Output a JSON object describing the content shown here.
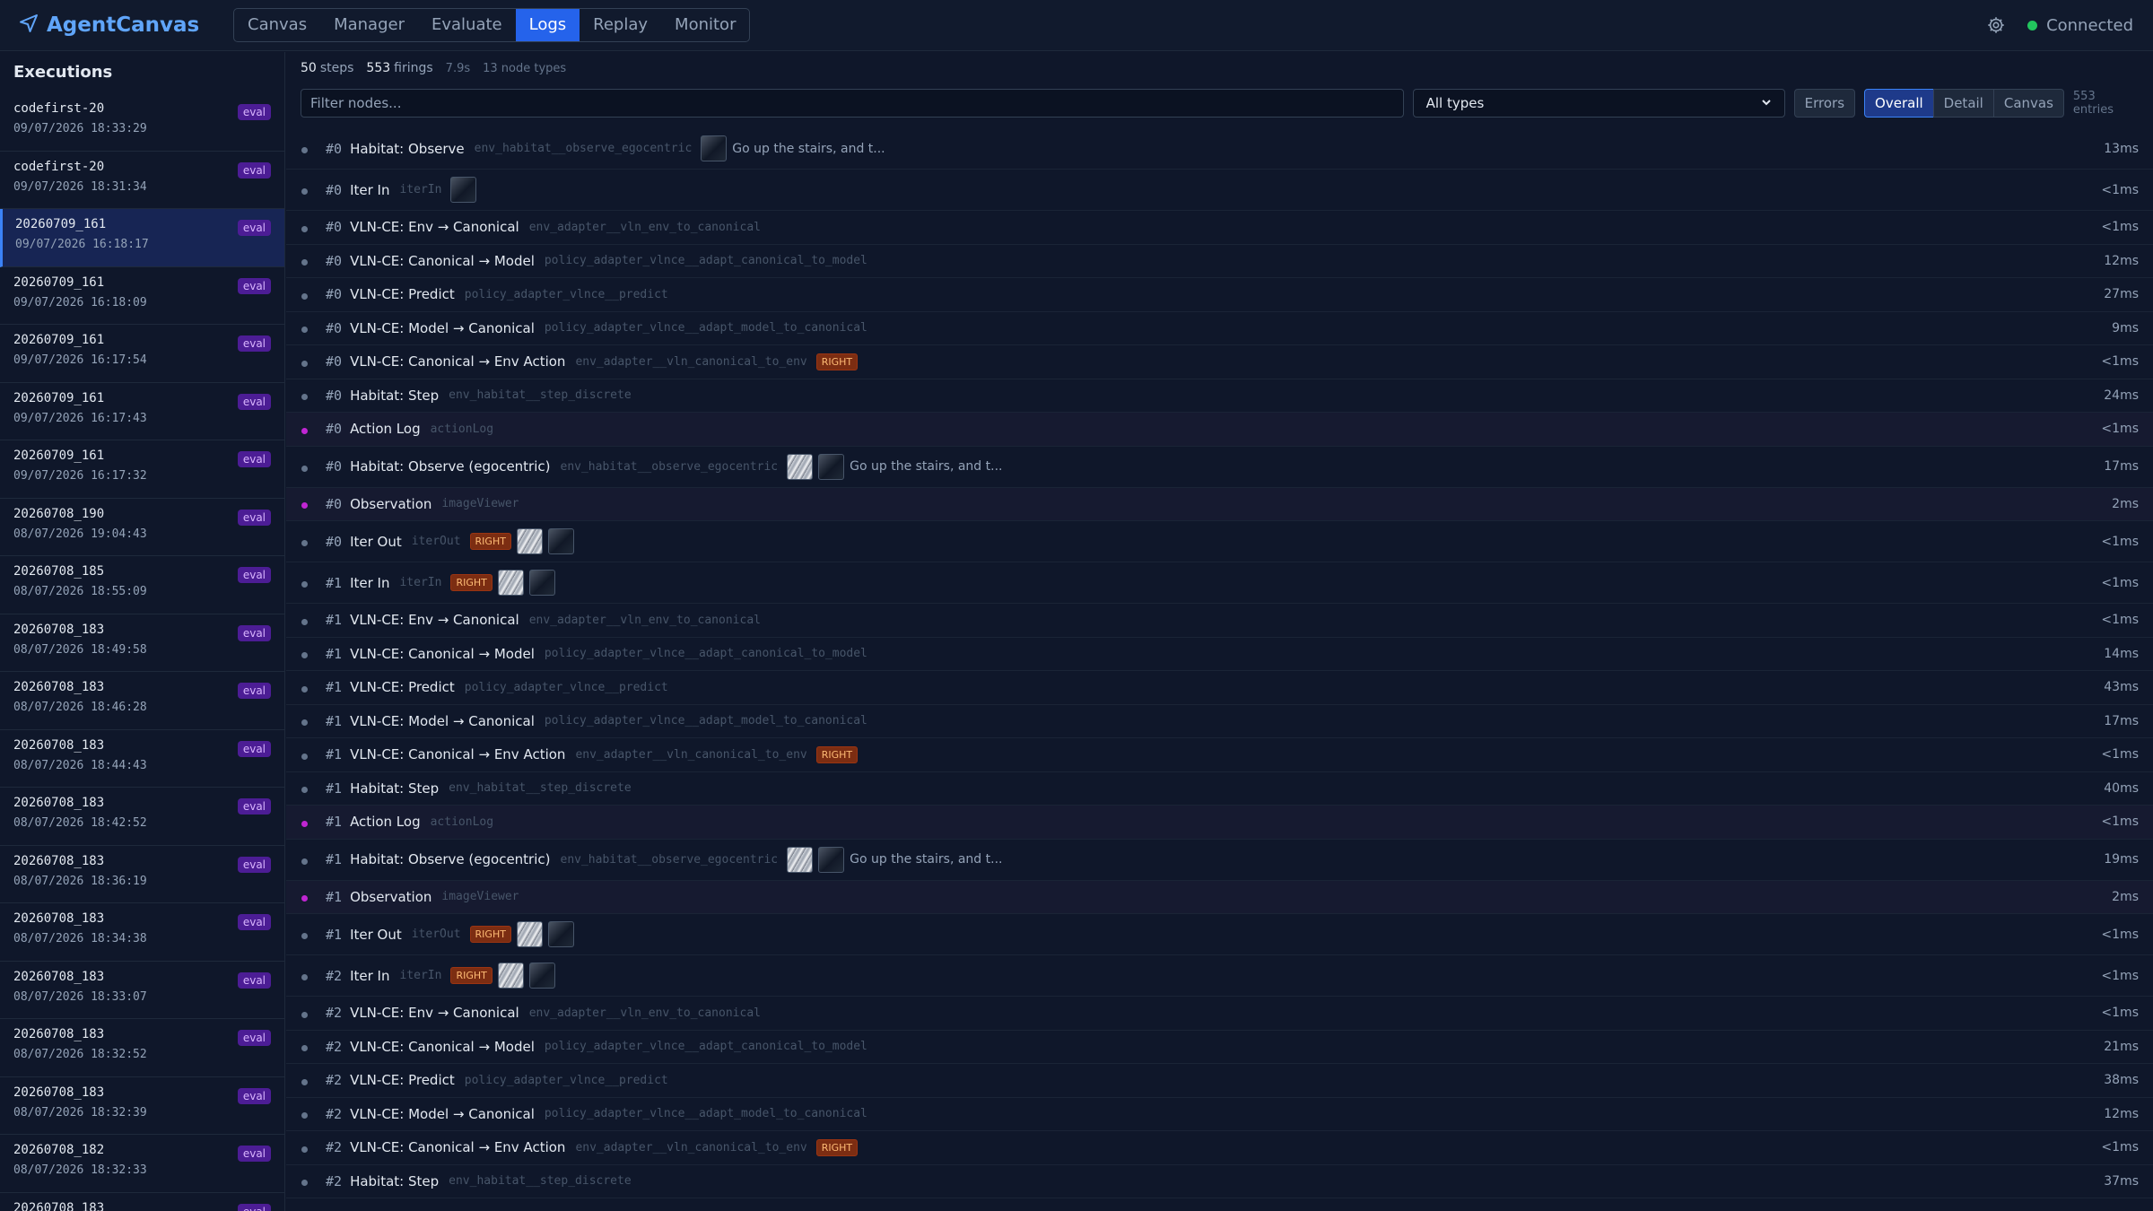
{
  "app": {
    "title": "AgentCanvas"
  },
  "nav": {
    "tabs": [
      {
        "label": "Canvas"
      },
      {
        "label": "Manager"
      },
      {
        "label": "Evaluate"
      },
      {
        "label": "Logs"
      },
      {
        "label": "Replay"
      },
      {
        "label": "Monitor"
      }
    ],
    "active": "Logs"
  },
  "status": {
    "label": "Connected"
  },
  "sidebar": {
    "title": "Executions",
    "items": [
      {
        "name": "codefirst-20",
        "date": "09/07/2026 18:33:29",
        "badge": "eval"
      },
      {
        "name": "codefirst-20",
        "date": "09/07/2026 18:31:34",
        "badge": "eval"
      },
      {
        "name": "20260709_161",
        "date": "09/07/2026 16:18:17",
        "badge": "eval"
      },
      {
        "name": "20260709_161",
        "date": "09/07/2026 16:18:09",
        "badge": "eval"
      },
      {
        "name": "20260709_161",
        "date": "09/07/2026 16:17:54",
        "badge": "eval"
      },
      {
        "name": "20260709_161",
        "date": "09/07/2026 16:17:43",
        "badge": "eval"
      },
      {
        "name": "20260709_161",
        "date": "09/07/2026 16:17:32",
        "badge": "eval"
      },
      {
        "name": "20260708_190",
        "date": "08/07/2026 19:04:43",
        "badge": "eval"
      },
      {
        "name": "20260708_185",
        "date": "08/07/2026 18:55:09",
        "badge": "eval"
      },
      {
        "name": "20260708_183",
        "date": "08/07/2026 18:49:58",
        "badge": "eval"
      },
      {
        "name": "20260708_183",
        "date": "08/07/2026 18:46:28",
        "badge": "eval"
      },
      {
        "name": "20260708_183",
        "date": "08/07/2026 18:44:43",
        "badge": "eval"
      },
      {
        "name": "20260708_183",
        "date": "08/07/2026 18:42:52",
        "badge": "eval"
      },
      {
        "name": "20260708_183",
        "date": "08/07/2026 18:36:19",
        "badge": "eval"
      },
      {
        "name": "20260708_183",
        "date": "08/07/2026 18:34:38",
        "badge": "eval"
      },
      {
        "name": "20260708_183",
        "date": "08/07/2026 18:33:07",
        "badge": "eval"
      },
      {
        "name": "20260708_183",
        "date": "08/07/2026 18:32:52",
        "badge": "eval"
      },
      {
        "name": "20260708_183",
        "date": "08/07/2026 18:32:39",
        "badge": "eval"
      },
      {
        "name": "20260708_182",
        "date": "08/07/2026 18:32:33",
        "badge": "eval"
      },
      {
        "name": "20260708_183",
        "date": "",
        "badge": "eval"
      }
    ]
  },
  "stats": {
    "steps_value": "50",
    "steps_label": "steps",
    "firings_value": "553",
    "firings_label": "firings",
    "duration": "7.9s",
    "node_types": "13 node types"
  },
  "filter": {
    "placeholder": "Filter nodes...",
    "type_select": "All types",
    "errors_label": "Errors",
    "view_modes": [
      "Overall",
      "Detail",
      "Canvas"
    ],
    "active_mode": "Overall",
    "entries": "553 entries"
  },
  "logs": [
    {
      "step": "#0",
      "name": "Habitat: Observe",
      "func": "env_habitat__observe_egocentric",
      "thumbs": [
        "dark"
      ],
      "text": "Go up the stairs, and t...",
      "time": "13ms",
      "tall": true
    },
    {
      "step": "#0",
      "name": "Iter In",
      "func": "iterIn",
      "thumbs": [
        "dark"
      ],
      "time": "<1ms",
      "tall": true
    },
    {
      "step": "#0",
      "name": "VLN-CE: Env → Canonical",
      "func": "env_adapter__vln_env_to_canonical",
      "time": "<1ms"
    },
    {
      "step": "#0",
      "name": "VLN-CE: Canonical → Model",
      "func": "policy_adapter_vlnce__adapt_canonical_to_model",
      "time": "12ms"
    },
    {
      "step": "#0",
      "name": "VLN-CE: Predict",
      "func": "policy_adapter_vlnce__predict",
      "time": "27ms"
    },
    {
      "step": "#0",
      "name": "VLN-CE: Model → Canonical",
      "func": "policy_adapter_vlnce__adapt_model_to_canonical",
      "time": "9ms"
    },
    {
      "step": "#0",
      "name": "VLN-CE: Canonical → Env Action",
      "func": "env_adapter__vln_canonical_to_env",
      "badge": "RIGHT",
      "time": "<1ms"
    },
    {
      "step": "#0",
      "name": "Habitat: Step",
      "func": "env_habitat__step_discrete",
      "time": "24ms"
    },
    {
      "step": "#0",
      "name": "Action Log",
      "func": "actionLog",
      "time": "<1ms",
      "purple": true
    },
    {
      "step": "#0",
      "name": "Habitat: Observe (egocentric)",
      "func": "env_habitat__observe_egocentric",
      "thumbs": [
        "stripe",
        "dark"
      ],
      "text": "Go up the stairs, and t...",
      "time": "17ms",
      "tall": true
    },
    {
      "step": "#0",
      "name": "Observation",
      "func": "imageViewer",
      "time": "2ms",
      "purple": true
    },
    {
      "step": "#0",
      "name": "Iter Out",
      "func": "iterOut",
      "badge": "RIGHT",
      "thumbs": [
        "stripe",
        "dark"
      ],
      "time": "<1ms",
      "tall": true
    },
    {
      "step": "#1",
      "name": "Iter In",
      "func": "iterIn",
      "badge": "RIGHT",
      "thumbs": [
        "stripe",
        "dark"
      ],
      "time": "<1ms",
      "tall": true
    },
    {
      "step": "#1",
      "name": "VLN-CE: Env → Canonical",
      "func": "env_adapter__vln_env_to_canonical",
      "time": "<1ms"
    },
    {
      "step": "#1",
      "name": "VLN-CE: Canonical → Model",
      "func": "policy_adapter_vlnce__adapt_canonical_to_model",
      "time": "14ms"
    },
    {
      "step": "#1",
      "name": "VLN-CE: Predict",
      "func": "policy_adapter_vlnce__predict",
      "time": "43ms"
    },
    {
      "step": "#1",
      "name": "VLN-CE: Model → Canonical",
      "func": "policy_adapter_vlnce__adapt_model_to_canonical",
      "time": "17ms"
    },
    {
      "step": "#1",
      "name": "VLN-CE: Canonical → Env Action",
      "func": "env_adapter__vln_canonical_to_env",
      "badge": "RIGHT",
      "time": "<1ms"
    },
    {
      "step": "#1",
      "name": "Habitat: Step",
      "func": "env_habitat__step_discrete",
      "time": "40ms"
    },
    {
      "step": "#1",
      "name": "Action Log",
      "func": "actionLog",
      "time": "<1ms",
      "purple": true
    },
    {
      "step": "#1",
      "name": "Habitat: Observe (egocentric)",
      "func": "env_habitat__observe_egocentric",
      "thumbs": [
        "stripe",
        "dark"
      ],
      "text": "Go up the stairs, and t...",
      "time": "19ms",
      "tall": true
    },
    {
      "step": "#1",
      "name": "Observation",
      "func": "imageViewer",
      "time": "2ms",
      "purple": true
    },
    {
      "step": "#1",
      "name": "Iter Out",
      "func": "iterOut",
      "badge": "RIGHT",
      "thumbs": [
        "stripe",
        "dark"
      ],
      "time": "<1ms",
      "tall": true
    },
    {
      "step": "#2",
      "name": "Iter In",
      "func": "iterIn",
      "badge": "RIGHT",
      "thumbs": [
        "stripe",
        "dark"
      ],
      "time": "<1ms",
      "tall": true
    },
    {
      "step": "#2",
      "name": "VLN-CE: Env → Canonical",
      "func": "env_adapter__vln_env_to_canonical",
      "time": "<1ms"
    },
    {
      "step": "#2",
      "name": "VLN-CE: Canonical → Model",
      "func": "policy_adapter_vlnce__adapt_canonical_to_model",
      "time": "21ms"
    },
    {
      "step": "#2",
      "name": "VLN-CE: Predict",
      "func": "policy_adapter_vlnce__predict",
      "time": "38ms"
    },
    {
      "step": "#2",
      "name": "VLN-CE: Model → Canonical",
      "func": "policy_adapter_vlnce__adapt_model_to_canonical",
      "time": "12ms"
    },
    {
      "step": "#2",
      "name": "VLN-CE: Canonical → Env Action",
      "func": "env_adapter__vln_canonical_to_env",
      "badge": "RIGHT",
      "time": "<1ms"
    },
    {
      "step": "#2",
      "name": "Habitat: Step",
      "func": "env_habitat__step_discrete",
      "time": "37ms"
    }
  ],
  "colors": {
    "accent": "#2563eb",
    "brand": "#60a5fa",
    "connected": "#22c55e",
    "badge_eval": "#4c1d95",
    "badge_right": "#7c2d12",
    "purple_dot": "#c026d3"
  },
  "icons": {
    "brand": "navigation-arrow-icon",
    "settings": "gear-icon",
    "status": "status-dot-icon"
  }
}
